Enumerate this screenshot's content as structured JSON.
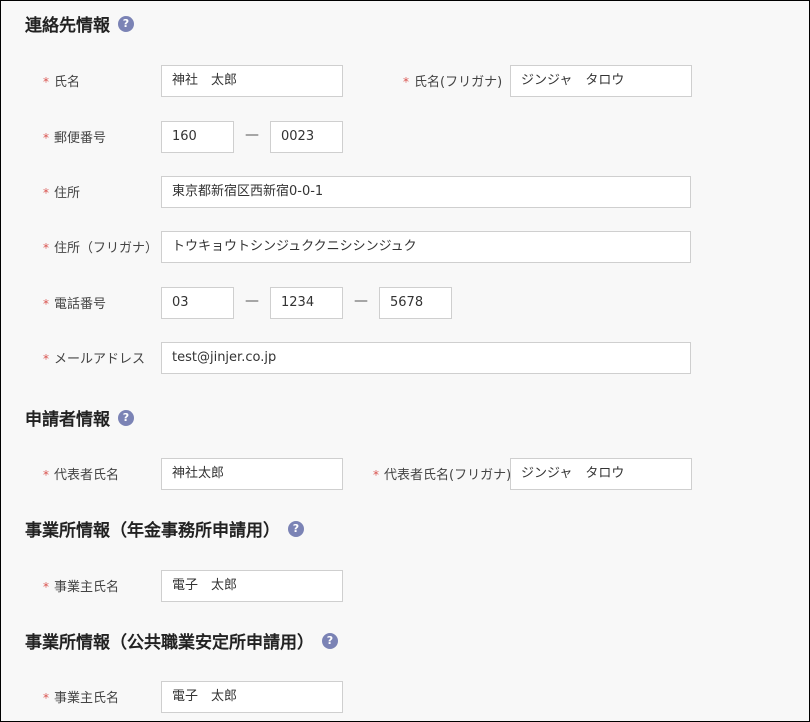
{
  "contact": {
    "title": "連絡先情報",
    "name": {
      "label": "氏名",
      "value": "神社　太郎"
    },
    "name_kana": {
      "label": "氏名(フリガナ)",
      "value": "ジンジャ　タロウ"
    },
    "postal": {
      "label": "郵便番号",
      "part1": "160",
      "part2": "0023"
    },
    "address": {
      "label": "住所",
      "value": "東京都新宿区西新宿0-0-1"
    },
    "address_kana": {
      "label": "住所（フリガナ）",
      "value": "トウキョウトシンジュククニシシンジュク"
    },
    "phone": {
      "label": "電話番号",
      "part1": "03",
      "part2": "1234",
      "part3": "5678"
    },
    "email": {
      "label": "メールアドレス",
      "value": "test@jinjer.co.jp"
    }
  },
  "applicant": {
    "title": "申請者情報",
    "rep_name": {
      "label": "代表者氏名",
      "value": "神社太郎"
    },
    "rep_name_kana": {
      "label": "代表者氏名(フリガナ)",
      "value": "ジンジャ　タロウ"
    }
  },
  "office_pension": {
    "title": "事業所情報（年金事務所申請用）",
    "owner_name": {
      "label": "事業主氏名",
      "value": "電子　太郎"
    }
  },
  "office_employment": {
    "title": "事業所情報（公共職業安定所申請用）",
    "owner_name": {
      "label": "事業主氏名",
      "value": "電子　太郎"
    }
  },
  "common": {
    "required_mark": "*",
    "help_icon": "?",
    "dash": "—"
  }
}
